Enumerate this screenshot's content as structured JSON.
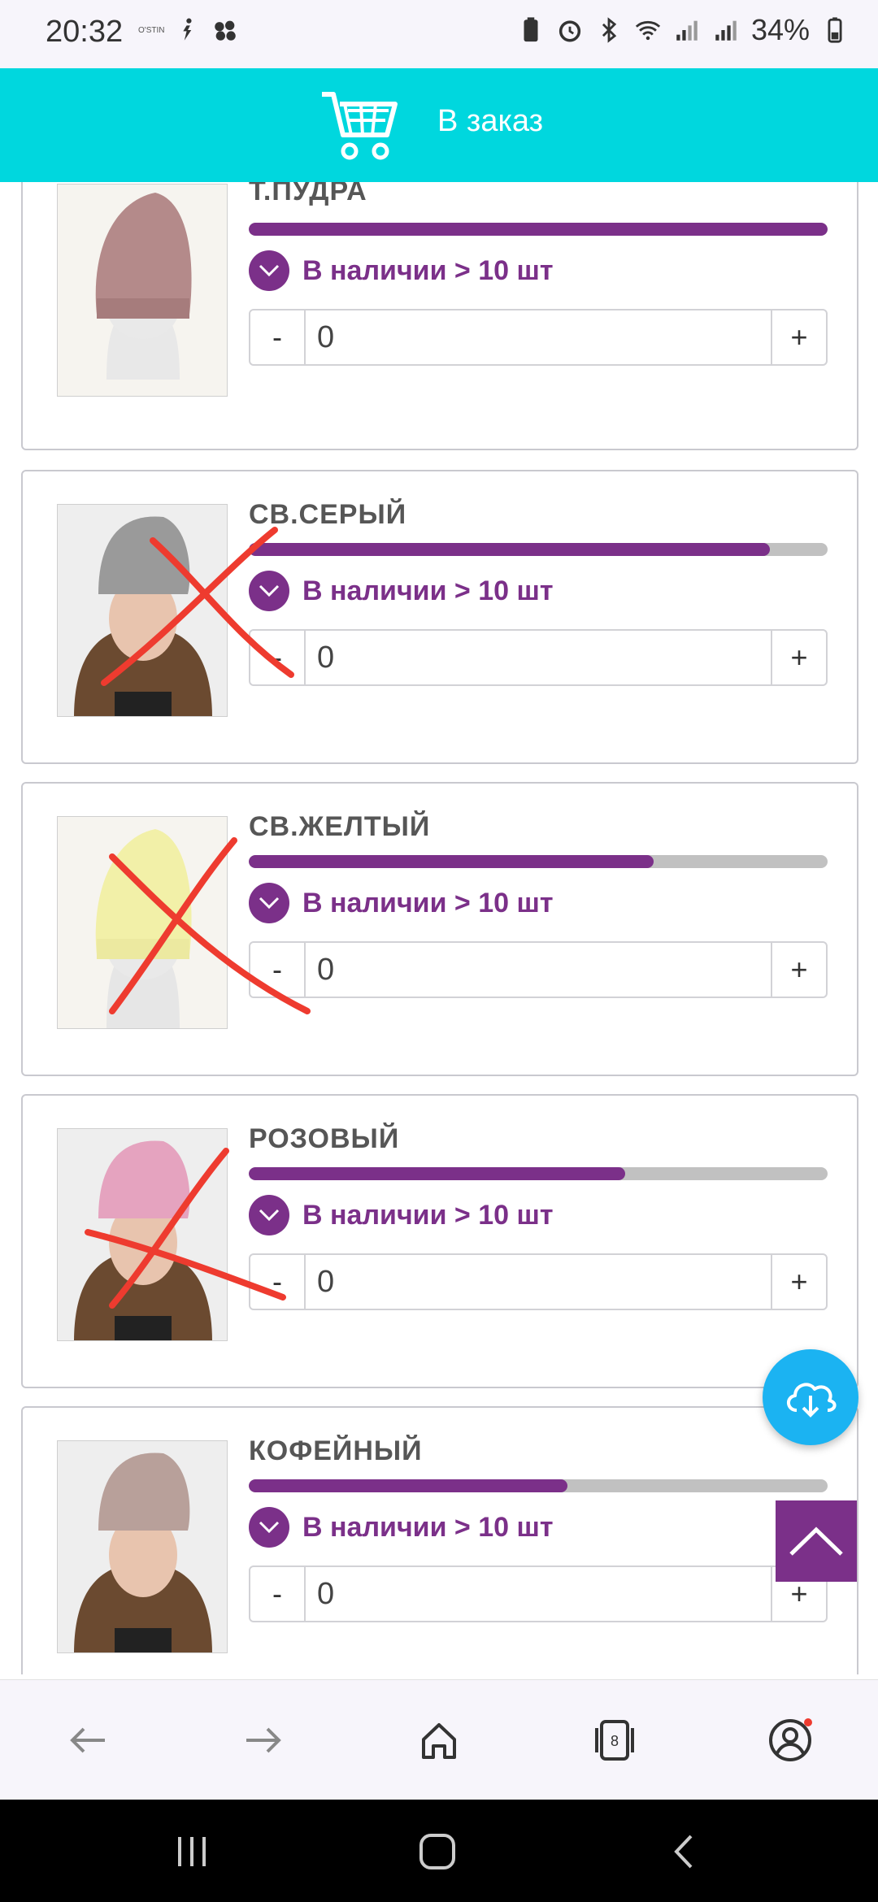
{
  "status": {
    "time": "20:32",
    "tiny_label": "O'STIN",
    "battery": "34%"
  },
  "header": {
    "title": "В заказ"
  },
  "products": [
    {
      "name": "Т.ПУДРА",
      "availability": "В наличии > 10 шт",
      "qty": "0",
      "stock_fraction": 1.0
    },
    {
      "name": "СВ.СЕРЫЙ",
      "availability": "В наличии > 10 шт",
      "qty": "0",
      "stock_fraction": 0.9
    },
    {
      "name": "СВ.ЖЕЛТЫЙ",
      "availability": "В наличии > 10 шт",
      "qty": "0",
      "stock_fraction": 0.7
    },
    {
      "name": "РОЗОВЫЙ",
      "availability": "В наличии > 10 шт",
      "qty": "0",
      "stock_fraction": 0.65
    },
    {
      "name": "КОФЕЙНЫЙ",
      "availability": "В наличии > 10 шт",
      "qty": "0",
      "stock_fraction": 0.55
    }
  ],
  "qty_controls": {
    "minus": "-",
    "plus": "+"
  },
  "browser": {
    "tabs_count": "8"
  },
  "colors": {
    "accent_cyan": "#00d7de",
    "brand_purple": "#7b3089",
    "fab_blue": "#1bb3f2",
    "strike_red": "#ee3b2f"
  }
}
